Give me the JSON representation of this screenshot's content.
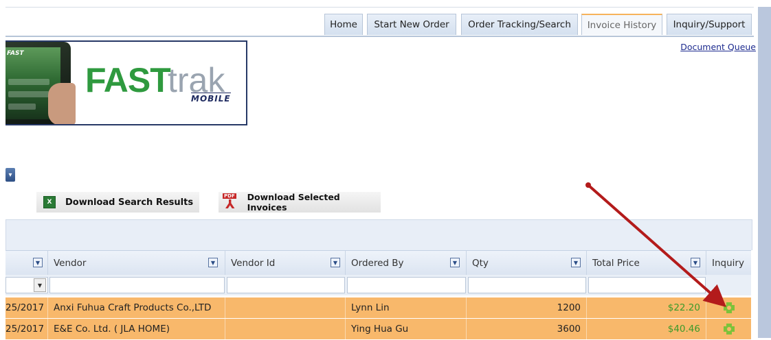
{
  "tabs": [
    {
      "label": "Home",
      "active": false
    },
    {
      "label": "Start New Order",
      "active": false
    },
    {
      "label": "Order Tracking/Search",
      "active": false
    },
    {
      "label": "Invoice History",
      "active": true
    },
    {
      "label": "Inquiry/Support",
      "active": false
    }
  ],
  "header": {
    "document_queue": "Document Queue"
  },
  "logo": {
    "fast": "FAST",
    "trak": "trak",
    "mobile": "MOBILE",
    "phone_brand": "FAST"
  },
  "actions": {
    "download_search_results": "Download Search Results",
    "download_selected_invoices": "Download Selected Invoices",
    "pdf_tag": "PDF"
  },
  "grid": {
    "columns": [
      "Vendor",
      "Vendor Id",
      "Ordered By",
      "Qty",
      "Total Price",
      "Inquiry"
    ],
    "rows": [
      {
        "date": "25/2017",
        "vendor": "Anxi Fuhua Craft Products Co.,LTD",
        "vendor_id": "",
        "ordered_by": "Lynn Lin",
        "qty": "1200",
        "total_price": "$22.20"
      },
      {
        "date": "25/2017",
        "vendor": "E&E Co. Ltd. ( JLA HOME)",
        "vendor_id": "",
        "ordered_by": "Ying Hua Gu",
        "qty": "3600",
        "total_price": "$40.46"
      }
    ]
  },
  "colors": {
    "row_highlight": "#f8b86b",
    "price_green": "#3b9a2a",
    "arrow_red": "#b31b1b",
    "active_tab_accent": "#f6b25a"
  }
}
